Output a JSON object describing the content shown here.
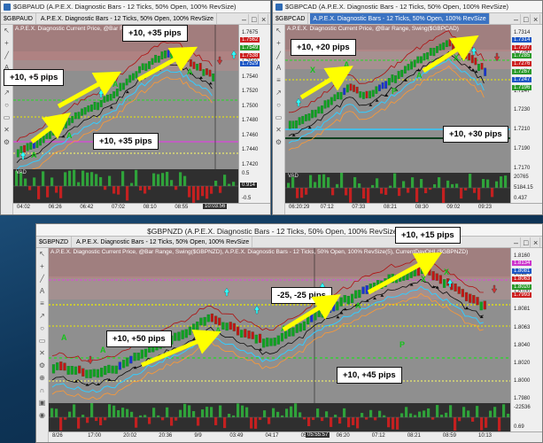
{
  "windows": {
    "gbpaud": {
      "title": "$GBPAUD (A.P.E.X. Diagnostic Bars - 12 Ticks, 50% Open, 100% RevSize)",
      "tabs": [
        "$GBPAUD",
        "A.P.E.X. Diagnostic Bars - 12 Ticks, 50% Open, 100% RevSize"
      ],
      "info": "A.P.E.X. Diagnostic Current Price, @Bar Range, Swing($GBPAUD)",
      "price_ticks": [
        "1.7675",
        "1.7600",
        "1.7560",
        "1.7540",
        "1.7520",
        "1.7500",
        "1.7480",
        "1.7460",
        "1.7440",
        "1.7420"
      ],
      "price_tags": [
        "1.7562",
        "1.7549",
        "1.7538",
        "1.7529"
      ],
      "sub_ticks": [
        "0.5",
        "0.0",
        "-0.5"
      ],
      "sub_tags": [
        "0.914"
      ],
      "sub_label": "VAD",
      "time_ticks": [
        "04:02",
        "06:26",
        "06:42",
        "07:02",
        "08:10",
        "08:55",
        "09:34"
      ],
      "cursor_time": "10:03:56"
    },
    "gbpcad": {
      "title": "$GBPCAD (A.P.E.X. Diagnostic Bars - 12 Ticks, 50% Open, 100% RevSize)",
      "tabs": [
        "$GBPCAD",
        "A.P.E.X. Diagnostic Bars - 12 Ticks, 50% Open, 100% RevSize"
      ],
      "info": "A.P.E.X. Diagnostic Current Price, @Bar Range, Swing($GBPCAD)",
      "price_ticks": [
        "1.7314",
        "1.7290",
        "1.7270",
        "1.7247",
        "1.7230",
        "1.7210",
        "1.7190",
        "1.7170"
      ],
      "price_tags": [
        "1.7314",
        "1.7297",
        "1.7285",
        "1.7276",
        "1.7267",
        "1.7247",
        "1.7196"
      ],
      "sub_ticks": [
        "20765",
        "5184.15",
        "0.437"
      ],
      "sub_label": "VAD",
      "time_ticks": [
        "06:20:29",
        "07:12",
        "07:33",
        "08:21",
        "08:30",
        "09:02",
        "09:23"
      ],
      "cursor_time": ""
    },
    "gbpnzd": {
      "title": "$GBPNZD (A.P.E.X. Diagnostic Bars - 12 Ticks, 50% Open, 100% RevSize)  9/9/2016",
      "tabs": [
        "$GBPNZD",
        "A.P.E.X. Diagnostic Bars - 12 Ticks, 50% Open, 100% RevSize"
      ],
      "info": "A.P.E.X. Diagnostic Current Price, @Bar Range, Swing($GBPNZD), A.P.E.X. Diagnostic Bars - 12 Ticks, 50% Open, 100% RevSize(5), CurrentDayOHL($GBPNZD)",
      "price_ticks": [
        "1.8160",
        "1.8134",
        "1.8100",
        "1.8081",
        "1.8063",
        "1.8040",
        "1.8020",
        "1.8000",
        "1.7980"
      ],
      "price_tags": [
        "1.8134",
        "1.8081",
        "1.8063",
        "1.8020",
        "1.7993"
      ],
      "sub_ticks": [
        "-22536",
        "0.69"
      ],
      "time_ticks": [
        "8/26",
        "17:00",
        "20:02",
        "20:36",
        "9/9",
        "03:49",
        "04:17",
        "05:02",
        "06:20",
        "07:12",
        "08:21",
        "08:59",
        "10:13"
      ],
      "cursor_time": "05:55:57"
    }
  },
  "annotations": [
    {
      "label": "+10, +35 pips"
    },
    {
      "label": "+10, +5 pips"
    },
    {
      "label": "+10, +35 pips"
    },
    {
      "label": "+10, +20 pips"
    },
    {
      "label": "+10, +30 pips"
    },
    {
      "label": "+10, +15 pips"
    },
    {
      "label": "-25, -25 pips"
    },
    {
      "label": "+10, +50 pips"
    },
    {
      "label": "+10, +45 pips"
    }
  ],
  "colors": {
    "up_bar": "#10a020",
    "down_bar": "#c21515",
    "chart_bg": "#8f8f8f",
    "arrow": "#ffff00",
    "target_line": "#ff33ff",
    "cyan": "#33ccff",
    "orange": "#ff9933"
  }
}
